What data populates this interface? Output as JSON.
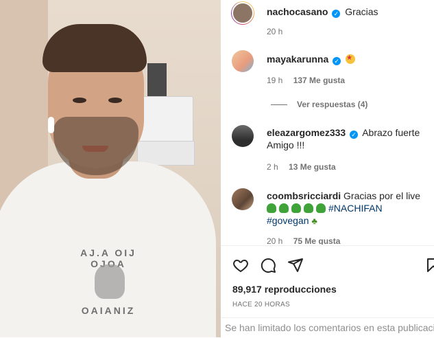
{
  "post": {
    "author": "nachocasano",
    "caption": "Gracias",
    "time": "20 h"
  },
  "comments": [
    {
      "user": "mayakarunna",
      "time": "19 h",
      "likes": "137 Me gusta"
    },
    {
      "user": "eleazargomez333",
      "text": "Abrazo fuerte Amigo !!!",
      "time": "2 h",
      "likes": "13 Me gusta"
    },
    {
      "user": "coombsricciardi",
      "text": "Gracias por el live",
      "hashtag1": "#NACHIFAN",
      "hashtag2": "#govegan",
      "time": "20 h",
      "likes": "75 Me gusta"
    }
  ],
  "replies_link": "Ver respuestas (4)",
  "stats": {
    "views": "89,917",
    "views_label": "reproducciones"
  },
  "posted_ago": "HACE 20 HORAS",
  "comments_limited": "Se han limitado los comentarios en esta publicación.",
  "video_shirt_text": {
    "top": "AJ.A OIJ OJOA",
    "bottom": "OAIANIZ"
  },
  "icons": {
    "verified": "verified-check-icon",
    "like": "heart-icon",
    "comment": "comment-bubble-icon",
    "share": "paper-plane-icon",
    "save": "bookmark-icon"
  },
  "colors": {
    "verified": "#0095f6",
    "hashtag": "#00376b",
    "muted": "#737373"
  }
}
